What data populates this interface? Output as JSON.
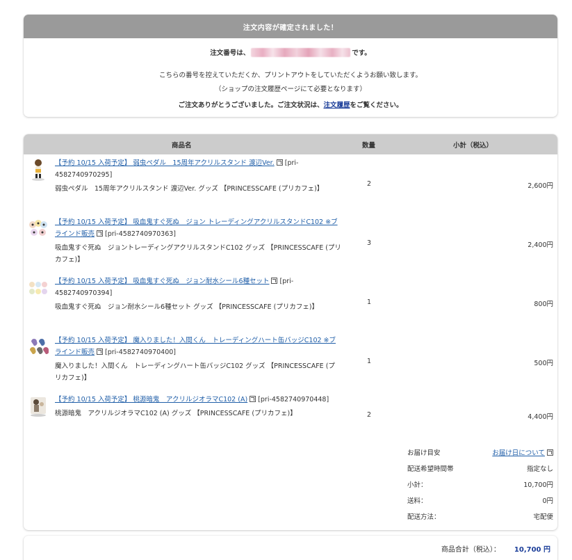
{
  "confirm": {
    "header": "注文内容が確定されました！",
    "order_prefix": "注文番号は、",
    "order_suffix": "です。",
    "note1": "こちらの番号を控えていただくか、プリントアウトをしていただくようお願い致します。",
    "note2": "（ショップの注文履歴ページにて必要となります）",
    "thanks_prefix": "ご注文ありがとうございました。ご注文状況は、",
    "thanks_link": "注文履歴",
    "thanks_suffix": "をご覧ください。"
  },
  "table": {
    "col_name": "商品名",
    "col_qty": "数量",
    "col_subtotal": "小計（税込）"
  },
  "items": [
    {
      "link": "【予約 10/15 入荷予定】 弱虫ペダル　15周年アクリルスタンド 渡辺Ver.",
      "code": "[pri-4582740970295]",
      "desc": "弱虫ペダル　15周年アクリルスタンド 渡辺Ver. グッズ 【PRINCESSCAFE (プリカフェ)】",
      "qty": "2",
      "subtotal": "2,600円"
    },
    {
      "link": "【予約 10/15 入荷予定】 吸血鬼すぐ死ぬ　ジョン トレーディングアクリルスタンドC102 ※ブラインド販売",
      "code": "[pri-4582740970363]",
      "desc": "吸血鬼すぐ死ぬ　ジョントレーディングアクリルスタンドC102 グッズ 【PRINCESSCAFE (プリカフェ)】",
      "qty": "3",
      "subtotal": "2,400円"
    },
    {
      "link": "【予約 10/15 入荷予定】 吸血鬼すぐ死ぬ　ジョン耐水シール6種セット",
      "code": "[pri-4582740970394]",
      "desc": "吸血鬼すぐ死ぬ　ジョン耐水シール6種セット グッズ 【PRINCESSCAFE (プリカフェ)】",
      "qty": "1",
      "subtotal": "800円"
    },
    {
      "link": "【予約 10/15 入荷予定】 魔入りました！入間くん　トレーディングハート缶バッジC102 ※ブラインド販売",
      "code": "[pri-4582740970400]",
      "desc": "魔入りました！入間くん　トレーディングハート缶バッジC102 グッズ 【PRINCESSCAFE (プリカフェ)】",
      "qty": "1",
      "subtotal": "500円"
    },
    {
      "link": "【予約 10/15 入荷予定】 桃源暗鬼　アクリルジオラマC102 (A)",
      "code": "[pri-4582740970448]",
      "desc": "桃源暗鬼　アクリルジオラマC102 (A) グッズ 【PRINCESSCAFE (プリカフェ)】",
      "qty": "2",
      "subtotal": "4,400円"
    }
  ],
  "summary": {
    "delivery_estimate_label": "お届け目安",
    "delivery_estimate_link": "お届け日について",
    "time_label": "配送希望時間帯",
    "time_value": "指定なし",
    "subtotal_label": "小計：",
    "subtotal_value": "10,700円",
    "shipping_label": "送料：",
    "shipping_value": "0円",
    "method_label": "配送方法：",
    "method_value": "宅配便"
  },
  "total": {
    "label": "商品合計（税込）：",
    "value": "10,700 円"
  },
  "icons": {
    "external": "external-link-icon"
  }
}
